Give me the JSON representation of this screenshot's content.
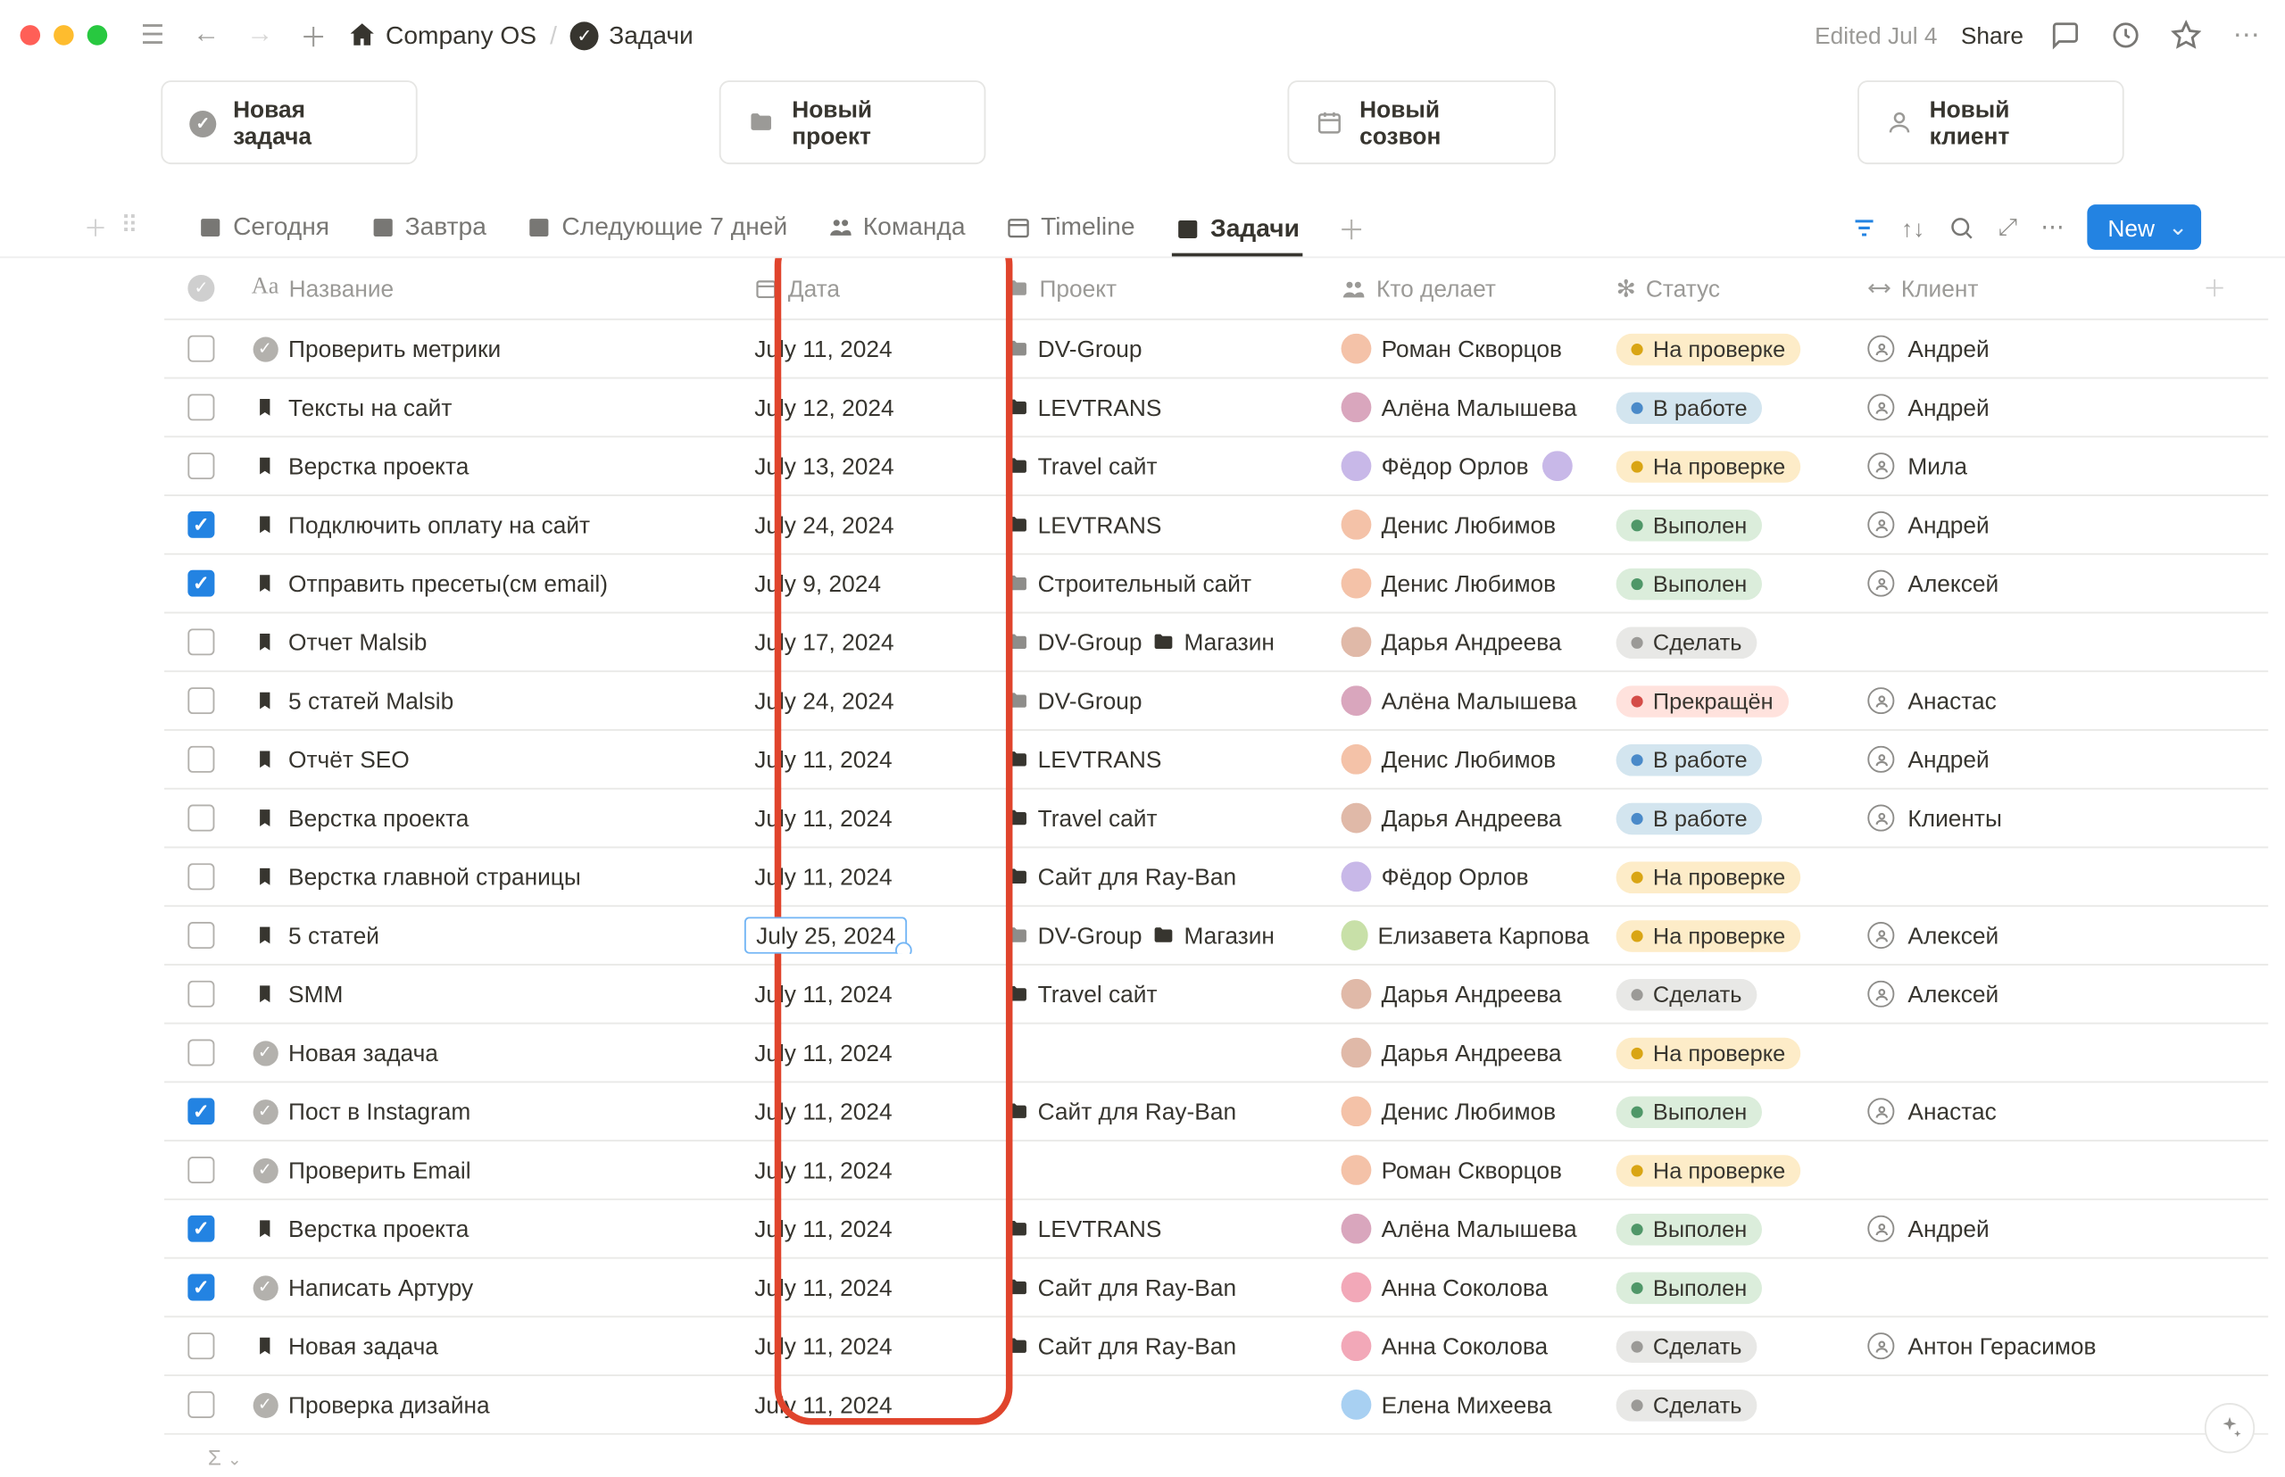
{
  "topbar": {
    "breadcrumb_root": "Company OS",
    "breadcrumb_page": "Задачи",
    "edited": "Edited Jul 4",
    "share": "Share"
  },
  "quick": [
    {
      "icon": "check-circle",
      "label": "Новая задача"
    },
    {
      "icon": "folder",
      "label": "Новый проект"
    },
    {
      "icon": "calendar",
      "label": "Новый созвон"
    },
    {
      "icon": "person",
      "label": "Новый клиент"
    }
  ],
  "views": [
    {
      "icon": "cal-grid",
      "label": "Сегодня",
      "active": false
    },
    {
      "icon": "cal-grid",
      "label": "Завтра",
      "active": false
    },
    {
      "icon": "cal-grid",
      "label": "Следующие 7 дней",
      "active": false
    },
    {
      "icon": "people",
      "label": "Команда",
      "active": false
    },
    {
      "icon": "cal-page",
      "label": "Timeline",
      "active": false
    },
    {
      "icon": "cal-grid",
      "label": "Задачи",
      "active": true
    }
  ],
  "newbtn": "New",
  "headers": {
    "name": "Название",
    "date": "Дата",
    "project": "Проект",
    "who": "Кто делает",
    "status": "Статус",
    "client": "Клиент"
  },
  "status_styles": {
    "На проверке": {
      "bg": "#fdecc8",
      "dot": "#d9a514"
    },
    "В работе": {
      "bg": "#d3e5ef",
      "dot": "#4a8ac9"
    },
    "Выполен": {
      "bg": "#dbeddb",
      "dot": "#4f9768"
    },
    "Сделать": {
      "bg": "#e8e8e6",
      "dot": "#9b9a97"
    },
    "Прекращён": {
      "bg": "#ffe2dd",
      "dot": "#d44c47"
    }
  },
  "avatar_colors": {
    "Роман Скворцов": "#f4c2a8",
    "Алёна Малышева": "#d9a6bd",
    "Фёдор Орлов": "#c8b8e8",
    "Денис Любимов": "#f4c2a8",
    "Дарья Андреева": "#e0b9a8",
    "Елизавета Карпова": "#c8e0a8",
    "Анна Соколова": "#f2a8b8",
    "Елена Михеева": "#a8d0f2"
  },
  "rows": [
    {
      "checked": false,
      "icon": "check",
      "name": "Проверить метрики",
      "date": "July 11, 2024",
      "projects": [
        {
          "t": "grey",
          "n": "DV-Group"
        }
      ],
      "who": "Роман Скворцов",
      "who_extra": false,
      "status": "На проверке",
      "client": "Андрей"
    },
    {
      "checked": false,
      "icon": "book",
      "name": "Тексты на сайт",
      "date": "July 12, 2024",
      "projects": [
        {
          "t": "black",
          "n": "LEVTRANS"
        }
      ],
      "who": "Алёна Малышева",
      "status": "В работе",
      "client": "Андрей"
    },
    {
      "checked": false,
      "icon": "book",
      "name": "Верстка проекта",
      "date": "July 13, 2024",
      "projects": [
        {
          "t": "black",
          "n": "Travel сайт"
        }
      ],
      "who": "Фёдор Орлов",
      "who_extra": true,
      "status": "На проверке",
      "client": "Мила"
    },
    {
      "checked": true,
      "icon": "book",
      "name": "Подключить оплату на сайт",
      "date": "July 24, 2024",
      "projects": [
        {
          "t": "black",
          "n": "LEVTRANS"
        }
      ],
      "who": "Денис Любимов",
      "status": "Выполен",
      "client": "Андрей"
    },
    {
      "checked": true,
      "icon": "book",
      "name": "Отправить пресеты(см email)",
      "date": "July 9, 2024",
      "projects": [
        {
          "t": "grey",
          "n": "Строительный сайт"
        }
      ],
      "who": "Денис Любимов",
      "status": "Выполен",
      "client": "Алексей"
    },
    {
      "checked": false,
      "icon": "book",
      "name": "Отчет Malsib",
      "date": "July 17, 2024",
      "projects": [
        {
          "t": "grey",
          "n": "DV-Group"
        },
        {
          "t": "black",
          "n": "Магазин"
        }
      ],
      "who": "Дарья Андреева",
      "status": "Сделать",
      "client": ""
    },
    {
      "checked": false,
      "icon": "book",
      "name": "5 статей Malsib",
      "date": "July 24, 2024",
      "projects": [
        {
          "t": "grey",
          "n": "DV-Group"
        }
      ],
      "who": "Алёна Малышева",
      "status": "Прекращён",
      "client": "Анастас"
    },
    {
      "checked": false,
      "icon": "book",
      "name": "Отчёт SEO",
      "date": "July 11, 2024",
      "projects": [
        {
          "t": "black",
          "n": "LEVTRANS"
        }
      ],
      "who": "Денис Любимов",
      "status": "В работе",
      "client": "Андрей"
    },
    {
      "checked": false,
      "icon": "book",
      "name": "Верстка проекта",
      "date": "July 11, 2024",
      "projects": [
        {
          "t": "black",
          "n": "Travel сайт"
        }
      ],
      "who": "Дарья Андреева",
      "status": "В работе",
      "client": "Клиенты"
    },
    {
      "checked": false,
      "icon": "book",
      "name": "Верстка главной страницы",
      "date": "July 11, 2024",
      "projects": [
        {
          "t": "black",
          "n": "Сайт для Ray-Ban"
        }
      ],
      "who": "Фёдор Орлов",
      "status": "На проверке",
      "client": ""
    },
    {
      "checked": false,
      "icon": "book",
      "name": "5 статей",
      "date": "July 25, 2024",
      "date_active": true,
      "projects": [
        {
          "t": "grey",
          "n": "DV-Group"
        },
        {
          "t": "black",
          "n": "Магазин"
        }
      ],
      "who": "Елизавета Карпова",
      "status": "На проверке",
      "client": "Алексей"
    },
    {
      "checked": false,
      "icon": "book",
      "name": "SMM",
      "date": "July 11, 2024",
      "projects": [
        {
          "t": "black",
          "n": "Travel сайт"
        }
      ],
      "who": "Дарья Андреева",
      "status": "Сделать",
      "client": "Алексей"
    },
    {
      "checked": false,
      "icon": "check",
      "name": "Новая задача",
      "date": "July 11, 2024",
      "projects": [],
      "who": "Дарья Андреева",
      "status": "На проверке",
      "client": ""
    },
    {
      "checked": true,
      "icon": "check",
      "name": "Пост в Instagram",
      "date": "July 11, 2024",
      "projects": [
        {
          "t": "black",
          "n": "Сайт для Ray-Ban"
        }
      ],
      "who": "Денис Любимов",
      "status": "Выполен",
      "client": "Анастас"
    },
    {
      "checked": false,
      "icon": "check",
      "name": "Проверить Email",
      "date": "July 11, 2024",
      "projects": [],
      "who": "Роман Скворцов",
      "status": "На проверке",
      "client": ""
    },
    {
      "checked": true,
      "icon": "book",
      "name": "Верстка проекта",
      "date": "July 11, 2024",
      "projects": [
        {
          "t": "black",
          "n": "LEVTRANS"
        }
      ],
      "who": "Алёна Малышева",
      "status": "Выполен",
      "client": "Андрей"
    },
    {
      "checked": true,
      "icon": "check",
      "name": "Написать Артуру",
      "date": "July 11, 2024",
      "projects": [
        {
          "t": "black",
          "n": "Сайт для Ray-Ban"
        }
      ],
      "who": "Анна Соколова",
      "status": "Выполен",
      "client": ""
    },
    {
      "checked": false,
      "icon": "book",
      "name": "Новая задача",
      "date": "July 11, 2024",
      "projects": [
        {
          "t": "black",
          "n": "Сайт для Ray-Ban"
        }
      ],
      "who": "Анна Соколова",
      "status": "Сделать",
      "client": "Антон Герасимов"
    },
    {
      "checked": false,
      "icon": "check",
      "name": "Проверка дизайна",
      "date": "July 11, 2024",
      "projects": [],
      "who": "Елена Михеева",
      "status": "Сделать",
      "client": ""
    }
  ],
  "sum": "Σ"
}
